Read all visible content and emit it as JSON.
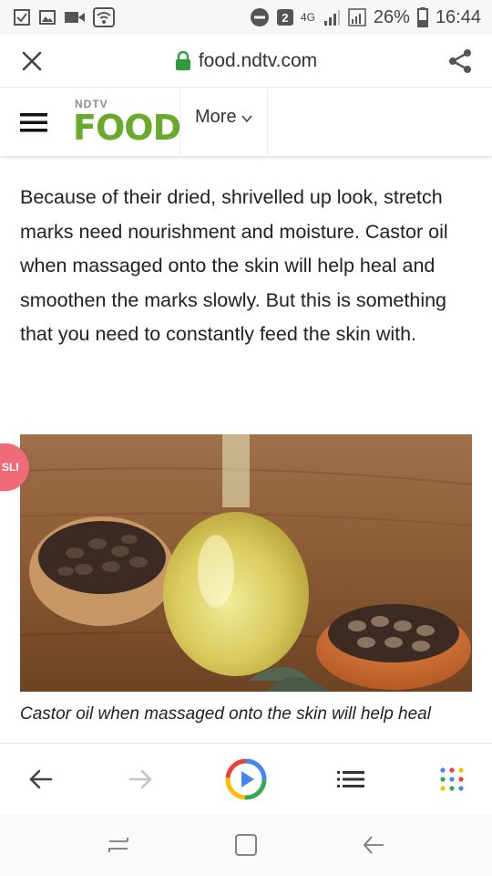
{
  "status_bar": {
    "battery_percent": "26%",
    "time": "16:44",
    "network": "4G",
    "notification_count": "2"
  },
  "browser": {
    "url": "food.ndtv.com"
  },
  "site": {
    "logo_top": "NDTV",
    "logo_main": "FOOD",
    "more_label": "More"
  },
  "article": {
    "paragraph": "Because of their dried, shrivelled up look, stretch marks need nourishment and moisture. Castor oil when massaged onto the skin will help heal and smoothen the marks slowly. But this is something that you need to constantly feed the skin with.",
    "caption": "Castor oil when massaged onto the skin will help heal",
    "float_badge": "SLI"
  },
  "colors": {
    "logo_green": "#6aaa2a",
    "lock_green": "#2e9b3a",
    "badge_pink": "#ef6b78"
  }
}
